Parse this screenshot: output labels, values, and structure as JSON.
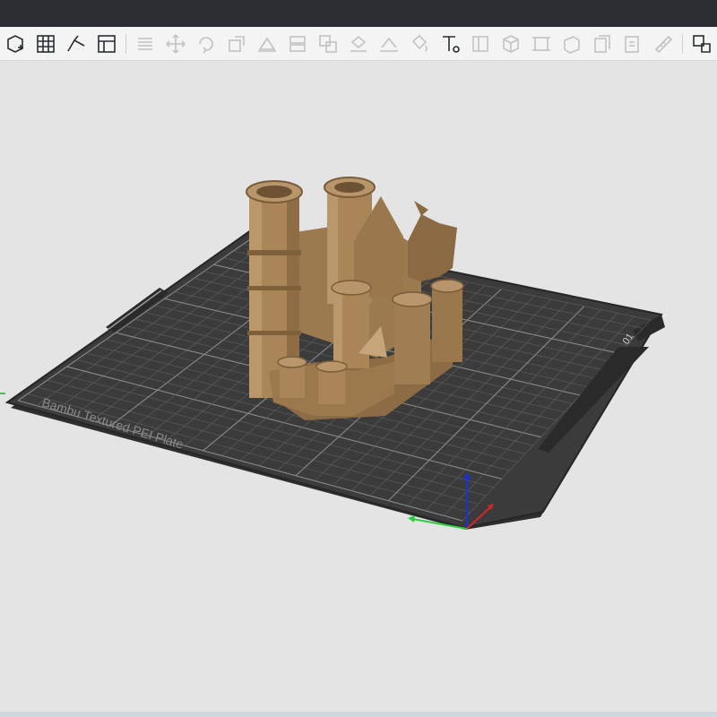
{
  "app": {
    "colors": {
      "titlebar": "#2b2f33",
      "toolbar_bg": "#f4f4f4",
      "viewport_bg": "#e4e4e4",
      "plate": "#3a3a3a",
      "grid_line": "#6a6a6a",
      "model": "#a98558",
      "axis_x": "#d62828",
      "axis_y": "#2ecc40",
      "axis_z": "#1f2fd1"
    }
  },
  "toolbar": {
    "buttons": [
      {
        "name": "add-object-button",
        "icon": "cube-plus-icon",
        "active": true
      },
      {
        "name": "arrange-button",
        "icon": "grid-icon",
        "active": true
      },
      {
        "name": "orient-button",
        "icon": "orient-icon",
        "active": true
      },
      {
        "name": "layout-button",
        "icon": "layout-icon",
        "active": true
      },
      {
        "name": "layers-button",
        "icon": "layers-icon",
        "active": false
      },
      {
        "name": "move-button",
        "icon": "move-icon",
        "active": false
      },
      {
        "name": "rotate-button",
        "icon": "rotate-icon",
        "active": false
      },
      {
        "name": "scale-button",
        "icon": "scale-icon",
        "active": false
      },
      {
        "name": "lay-on-face-button",
        "icon": "lay-face-icon",
        "active": false
      },
      {
        "name": "cut-button",
        "icon": "cut-icon",
        "active": false
      },
      {
        "name": "boolean-button",
        "icon": "boolean-icon",
        "active": false
      },
      {
        "name": "support-paint-button",
        "icon": "support-icon",
        "active": false
      },
      {
        "name": "seam-paint-button",
        "icon": "seam-icon",
        "active": false
      },
      {
        "name": "paint-bucket-button",
        "icon": "bucket-icon",
        "active": false
      },
      {
        "name": "text-button",
        "icon": "text-icon",
        "active": true
      },
      {
        "name": "mesh-button",
        "icon": "mesh-icon",
        "active": false
      },
      {
        "name": "cube-view-button",
        "icon": "cube-icon",
        "active": false
      },
      {
        "name": "frame-button",
        "icon": "frame-icon",
        "active": false
      },
      {
        "name": "solid-view-button",
        "icon": "solid-icon",
        "active": false
      },
      {
        "name": "copy-button",
        "icon": "copy-icon",
        "active": false
      },
      {
        "name": "paste-button",
        "icon": "paste-icon",
        "active": false
      },
      {
        "name": "measure-button",
        "icon": "ruler-icon",
        "active": false
      },
      {
        "name": "assembly-button",
        "icon": "assembly-icon",
        "active": true
      }
    ]
  },
  "viewport": {
    "plate_label": "Bambu Textured PEI Plate",
    "plate_number": "01"
  }
}
